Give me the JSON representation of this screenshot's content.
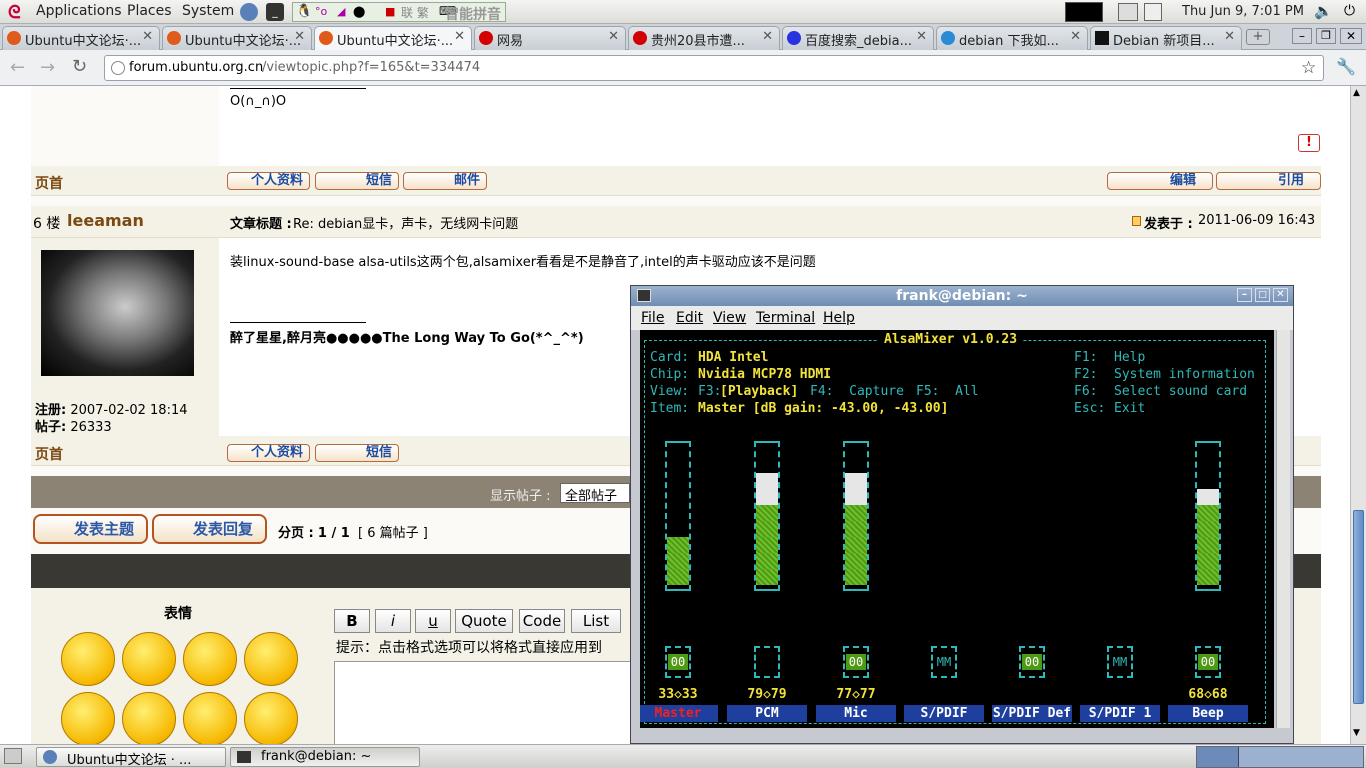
{
  "panel": {
    "applications": "Applications",
    "places": "Places",
    "system": "System",
    "ime": "智能拼音",
    "clock": "Thu Jun  9,  7:01 PM"
  },
  "tabs": [
    {
      "label": "Ubuntu中文论坛·..."
    },
    {
      "label": "Ubuntu中文论坛·..."
    },
    {
      "label": "Ubuntu中文论坛·..."
    },
    {
      "label": "网易"
    },
    {
      "label": "贵州20县市遭..."
    },
    {
      "label": "百度搜索_debia..."
    },
    {
      "label": "debian 下我如..."
    },
    {
      "label": "Debian 新项目..."
    }
  ],
  "url": {
    "host": "forum.ubuntu.org.cn",
    "path": "/viewtopic.php?f=165&t=334474"
  },
  "post5": {
    "sig": "O(∩_∩)O",
    "top": "页首",
    "btn_profile": "个人资料",
    "btn_pm": "短信",
    "btn_mail": "邮件",
    "btn_edit": "编辑",
    "btn_quote": "引用"
  },
  "post6": {
    "floor": "6 楼",
    "author": "leeaman",
    "subject_label": "文章标题 :",
    "subject": "Re: debian显卡，声卡，无线网卡问题",
    "posted_label": "发表于 :",
    "posted": "2011-06-09 16:43",
    "body": "装linux-sound-base alsa-utils这两个包,alsamixer看看是不是静音了,intel的声卡驱动应该不是问题",
    "sig": "醉了星星,醉月亮●●●●●The Long Way To Go(*^_^*)",
    "reg_label": "注册:",
    "reg": "2007-02-02 18:14",
    "posts_label": "帖子:",
    "posts": "26333",
    "top": "页首",
    "btn_profile": "个人资料",
    "btn_pm": "短信"
  },
  "bottom": {
    "show_label": "显示帖子 :",
    "show_value": "全部帖子",
    "new_topic": "发表主题",
    "reply": "发表回复",
    "pages_label": "分页 :",
    "pages": "1 / 1",
    "count": "[ 6 篇帖子 ]"
  },
  "reply": {
    "smilies": "表情",
    "fmt": [
      "B",
      "i",
      "u",
      "Quote",
      "Code",
      "List"
    ],
    "hint": "提示：点击格式选项可以将格式直接应用到"
  },
  "terminal": {
    "title": "frank@debian: ~",
    "menu": [
      "File",
      "Edit",
      "View",
      "Terminal",
      "Help"
    ],
    "mixer_title": "AlsaMixer v1.0.23",
    "card_label": "Card:",
    "card": "HDA Intel",
    "chip_label": "Chip:",
    "chip": "Nvidia MCP78 HDMI",
    "view_label": "View:",
    "view_f3": "F3:",
    "view_playback": "[Playback]",
    "view_f4": "F4:  Capture",
    "view_f5": "F5:  All",
    "item_label": "Item:",
    "item": "Master [dB gain: -43.00, -43.00]",
    "keys": [
      {
        "k": "F1:",
        "v": "Help"
      },
      {
        "k": "F2:",
        "v": "System information"
      },
      {
        "k": "F6:",
        "v": "Select sound card"
      },
      {
        "k": "Esc:",
        "v": "Exit"
      }
    ],
    "channels": [
      {
        "name": "Master",
        "value": "33<>33",
        "level": 0.33,
        "mute": "00",
        "selected": true
      },
      {
        "name": "PCM",
        "value": "79<>79",
        "level": 0.79,
        "mute": "",
        "selected": false
      },
      {
        "name": "Mic",
        "value": "77<>77",
        "level": 0.77,
        "mute": "00",
        "selected": false
      },
      {
        "name": "S/PDIF",
        "value": "",
        "level": 0,
        "mute": "MM",
        "selected": false
      },
      {
        "name": "S/PDIF Def",
        "value": "",
        "level": 0,
        "mute": "00",
        "selected": false
      },
      {
        "name": "S/PDIF 1",
        "value": "",
        "level": 0,
        "mute": "MM",
        "selected": false
      },
      {
        "name": "Beep",
        "value": "68<>68",
        "level": 0.68,
        "mute": "00",
        "selected": false
      }
    ]
  },
  "taskbar": [
    {
      "label": "Ubuntu中文论坛 · ..."
    },
    {
      "label": "frank@debian: ~"
    }
  ]
}
